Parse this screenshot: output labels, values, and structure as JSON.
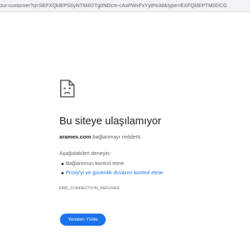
{
  "browser": {
    "url": "our-customer?q=SEFXQklEPS0yNTM4OTg0NDcm-cAxPWxFxYy8%3d&type=EXFQklEPTM0DCG"
  },
  "error_page": {
    "icon": "sad-page-icon",
    "headline": "Bu siteye ulaşılamıyor",
    "host": "aramex.com",
    "message_suffix": " bağlanmayı reddetti.",
    "try_label": "Aşağıdakileri deneyin:",
    "suggestions": [
      {
        "text": "Bağlantınızı kontrol etme",
        "is_link": false
      },
      {
        "text": "Proxy'yi ve güvenlik duvarını kontrol etme",
        "is_link": true
      }
    ],
    "error_code": "ERR_CONNECTION_REFUSED",
    "reload_label": "Yeniden Yükle"
  },
  "colors": {
    "accent": "#1a73e8",
    "text_primary": "#202124",
    "text_secondary": "#5f6368"
  }
}
